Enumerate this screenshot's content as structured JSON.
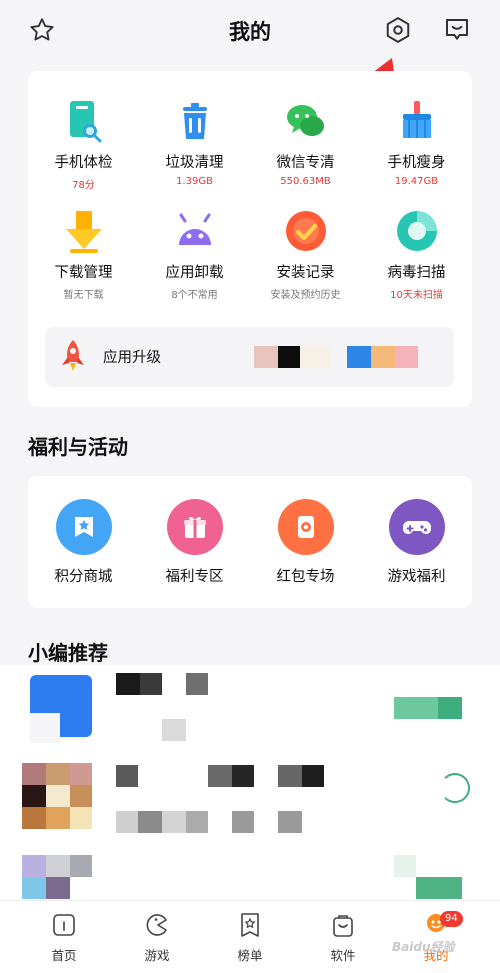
{
  "header": {
    "title": "我的",
    "icons": [
      "star-icon",
      "settings-icon",
      "message-icon"
    ]
  },
  "annotation": {
    "color": "#ec2f2f",
    "shape": "arrow-pointing-to-settings"
  },
  "tools": [
    {
      "label": "手机体检",
      "sub": "78分",
      "sub_color": "red",
      "icon": "phone-scan-icon"
    },
    {
      "label": "垃圾清理",
      "sub": "1.39GB",
      "sub_color": "red",
      "icon": "trash-icon"
    },
    {
      "label": "微信专清",
      "sub": "550.63MB",
      "sub_color": "red",
      "icon": "wechat-icon"
    },
    {
      "label": "手机瘦身",
      "sub": "19.47GB",
      "sub_color": "red",
      "icon": "broom-icon"
    },
    {
      "label": "下载管理",
      "sub": "暂无下载",
      "sub_color": "gray",
      "icon": "download-icon"
    },
    {
      "label": "应用卸载",
      "sub": "8个不常用",
      "sub_color": "gray",
      "icon": "android-icon"
    },
    {
      "label": "安装记录",
      "sub": "安装及预约历史",
      "sub_color": "gray",
      "icon": "check-circle-icon"
    },
    {
      "label": "病毒扫描",
      "sub": "10天未扫描",
      "sub_color": "red",
      "icon": "virus-scan-icon"
    }
  ],
  "upgrade": {
    "label": "应用升级",
    "icon": "rocket-icon"
  },
  "welfare": {
    "title": "福利与活动",
    "items": [
      {
        "label": "积分商城",
        "icon": "points-mall-icon",
        "color": "#42a5f5"
      },
      {
        "label": "福利专区",
        "icon": "gift-icon",
        "color": "#f06292"
      },
      {
        "label": "红包专场",
        "icon": "red-packet-icon",
        "color": "#ff7043"
      },
      {
        "label": "游戏福利",
        "icon": "gamepad-icon",
        "color": "#7e57c2"
      }
    ]
  },
  "recommend": {
    "title": "小编推荐"
  },
  "tabbar": {
    "items": [
      {
        "label": "首页",
        "icon": "home-icon"
      },
      {
        "label": "游戏",
        "icon": "game-icon"
      },
      {
        "label": "榜单",
        "icon": "ranking-icon"
      },
      {
        "label": "软件",
        "icon": "software-bag-icon"
      },
      {
        "label": "我的",
        "icon": "profile-icon"
      }
    ],
    "active": "我的",
    "badge": "94"
  },
  "watermark": "Baidu经验",
  "colors": {
    "accent": "#ff6a00",
    "red_text": "#e53935",
    "badge": "#f23b2f"
  }
}
